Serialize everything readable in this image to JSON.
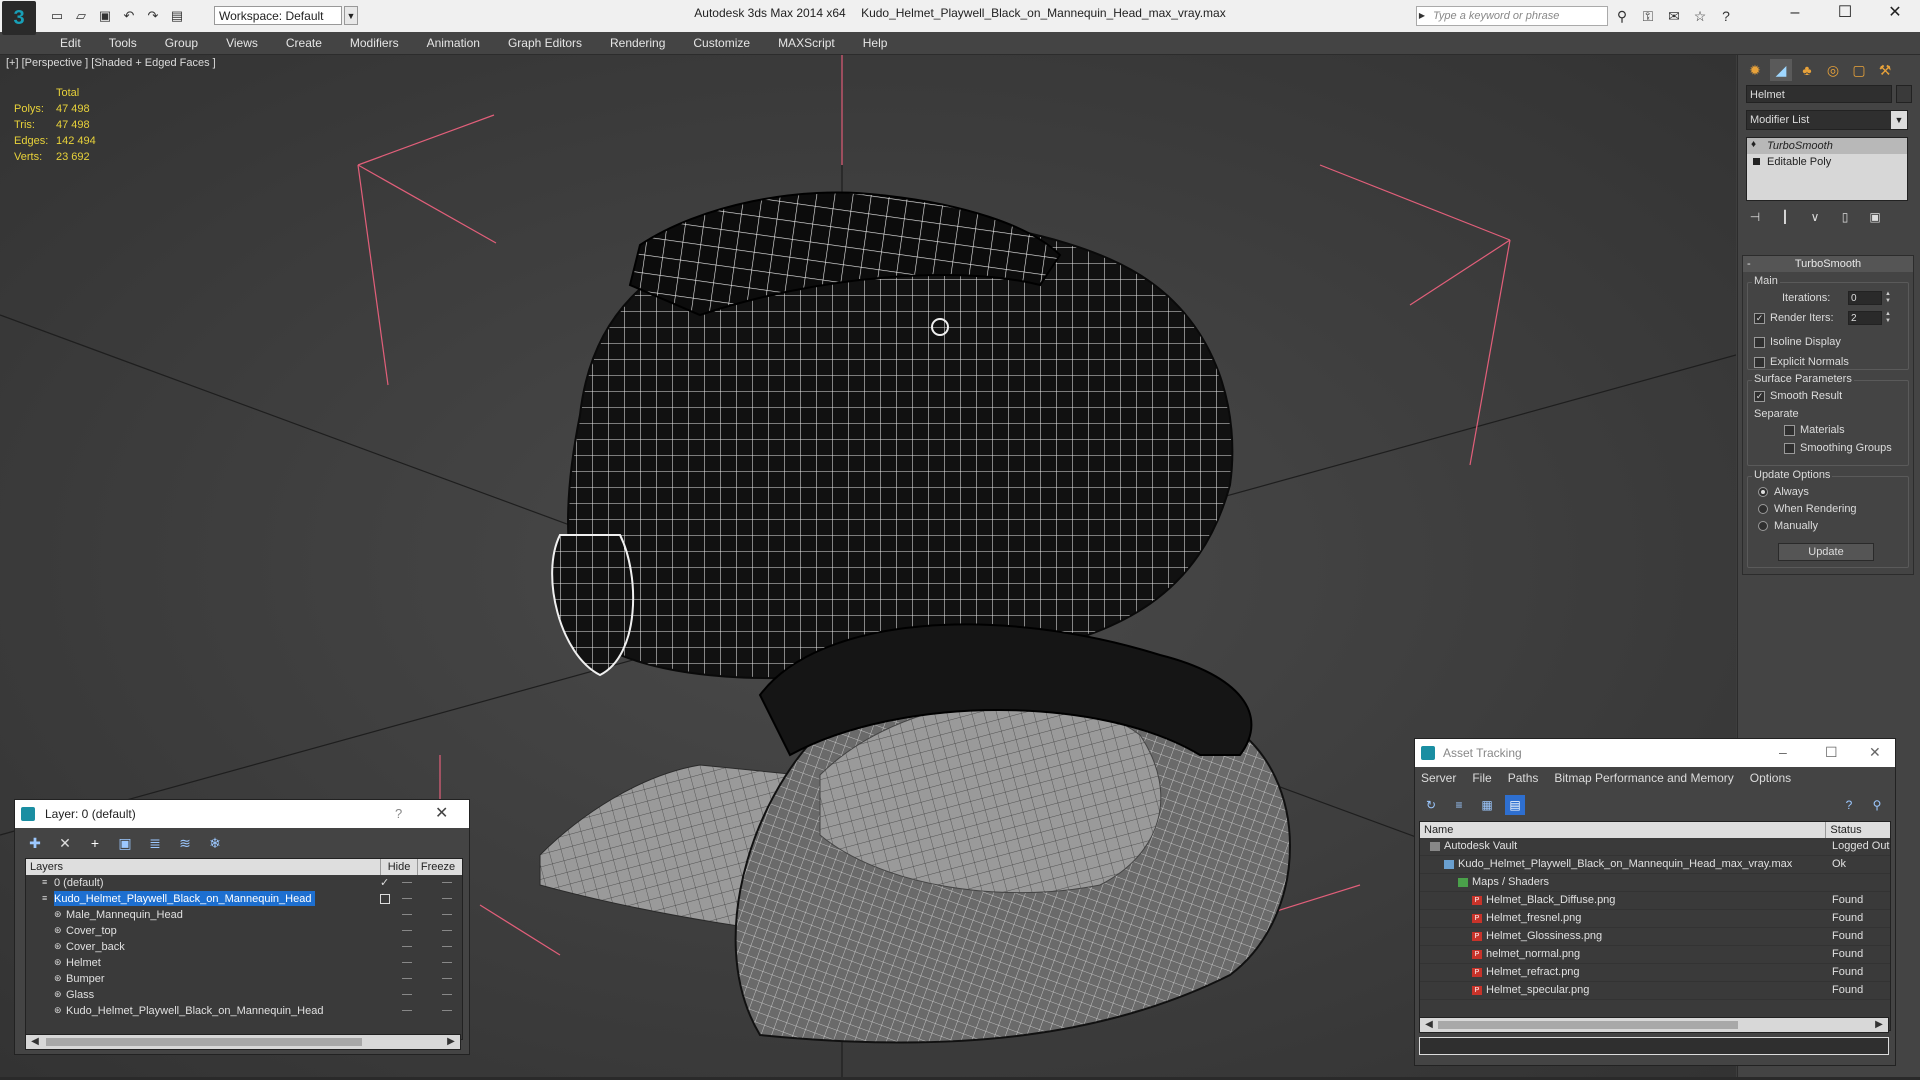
{
  "window": {
    "app_title": "Autodesk 3ds Max  2014 x64",
    "file_title": "Kudo_Helmet_Playwell_Black_on_Mannequin_Head_max_vray.max",
    "workspace_label": "Workspace: Default",
    "search_placeholder": "Type a keyword or phrase",
    "logo_glyph": "3",
    "minimize": "–",
    "maximize": "☐",
    "close": "✕"
  },
  "menu": [
    "Edit",
    "Tools",
    "Group",
    "Views",
    "Create",
    "Modifiers",
    "Animation",
    "Graph Editors",
    "Rendering",
    "Customize",
    "MAXScript",
    "Help"
  ],
  "viewport": {
    "label": "[+] [Perspective ] [Shaded + Edged Faces ]",
    "stats": {
      "header": "Total",
      "polys_label": "Polys:",
      "polys": "47 498",
      "tris_label": "Tris:",
      "tris": "47 498",
      "edges_label": "Edges:",
      "edges": "142 494",
      "verts_label": "Verts:",
      "verts": "23 692"
    },
    "accent_color": "#e8d23a"
  },
  "command_panel": {
    "object_name": "Helmet",
    "modifier_list": "Modifier List",
    "stack": [
      "TurboSmooth",
      "Editable Poly"
    ],
    "rollout": {
      "title": "TurboSmooth",
      "main_group": "Main",
      "iterations_label": "Iterations:",
      "iterations_value": "0",
      "render_iters_label": "Render Iters:",
      "render_iters_value": "2",
      "isoline_label": "Isoline Display",
      "explicit_normals_label": "Explicit Normals",
      "surface_group": "Surface Parameters",
      "smooth_result_label": "Smooth Result",
      "separate_label": "Separate",
      "materials_label": "Materials",
      "smoothing_groups_label": "Smoothing Groups",
      "update_group": "Update Options",
      "always_label": "Always",
      "when_rendering_label": "When Rendering",
      "manually_label": "Manually",
      "update_button": "Update"
    }
  },
  "layer_window": {
    "title": "Layer: 0 (default)",
    "help": "?",
    "close": "✕",
    "columns": [
      "Layers",
      "Hide",
      "Freeze"
    ],
    "rows": [
      {
        "name": "0 (default)",
        "indent": 1,
        "selected": false,
        "check": true
      },
      {
        "name": "Kudo_Helmet_Playwell_Black_on_Mannequin_Head",
        "indent": 1,
        "selected": true,
        "check": false
      },
      {
        "name": "Male_Mannequin_Head",
        "indent": 2,
        "selected": false,
        "check": false
      },
      {
        "name": "Cover_top",
        "indent": 2,
        "selected": false,
        "check": false
      },
      {
        "name": "Cover_back",
        "indent": 2,
        "selected": false,
        "check": false
      },
      {
        "name": "Helmet",
        "indent": 2,
        "selected": false,
        "check": false
      },
      {
        "name": "Bumper",
        "indent": 2,
        "selected": false,
        "check": false
      },
      {
        "name": "Glass",
        "indent": 2,
        "selected": false,
        "check": false
      },
      {
        "name": "Kudo_Helmet_Playwell_Black_on_Mannequin_Head",
        "indent": 2,
        "selected": false,
        "check": false
      }
    ]
  },
  "asset_window": {
    "title": "Asset Tracking",
    "menu": [
      "Server",
      "File",
      "Paths",
      "Bitmap Performance and Memory",
      "Options"
    ],
    "columns": [
      "Name",
      "Status"
    ],
    "rows": [
      {
        "name": "Autodesk Vault",
        "status": "Logged Out",
        "indent": 1,
        "icon": "vault"
      },
      {
        "name": "Kudo_Helmet_Playwell_Black_on_Mannequin_Head_max_vray.max",
        "status": "Ok",
        "indent": 2,
        "icon": "max"
      },
      {
        "name": "Maps / Shaders",
        "status": "",
        "indent": 3,
        "icon": "maps"
      },
      {
        "name": "Helmet_Black_Diffuse.png",
        "status": "Found",
        "indent": 4,
        "icon": "png"
      },
      {
        "name": "Helmet_fresnel.png",
        "status": "Found",
        "indent": 4,
        "icon": "png"
      },
      {
        "name": "Helmet_Glossiness.png",
        "status": "Found",
        "indent": 4,
        "icon": "png"
      },
      {
        "name": "helmet_normal.png",
        "status": "Found",
        "indent": 4,
        "icon": "png"
      },
      {
        "name": "Helmet_refract.png",
        "status": "Found",
        "indent": 4,
        "icon": "png"
      },
      {
        "name": "Helmet_specular.png",
        "status": "Found",
        "indent": 4,
        "icon": "png"
      }
    ]
  }
}
